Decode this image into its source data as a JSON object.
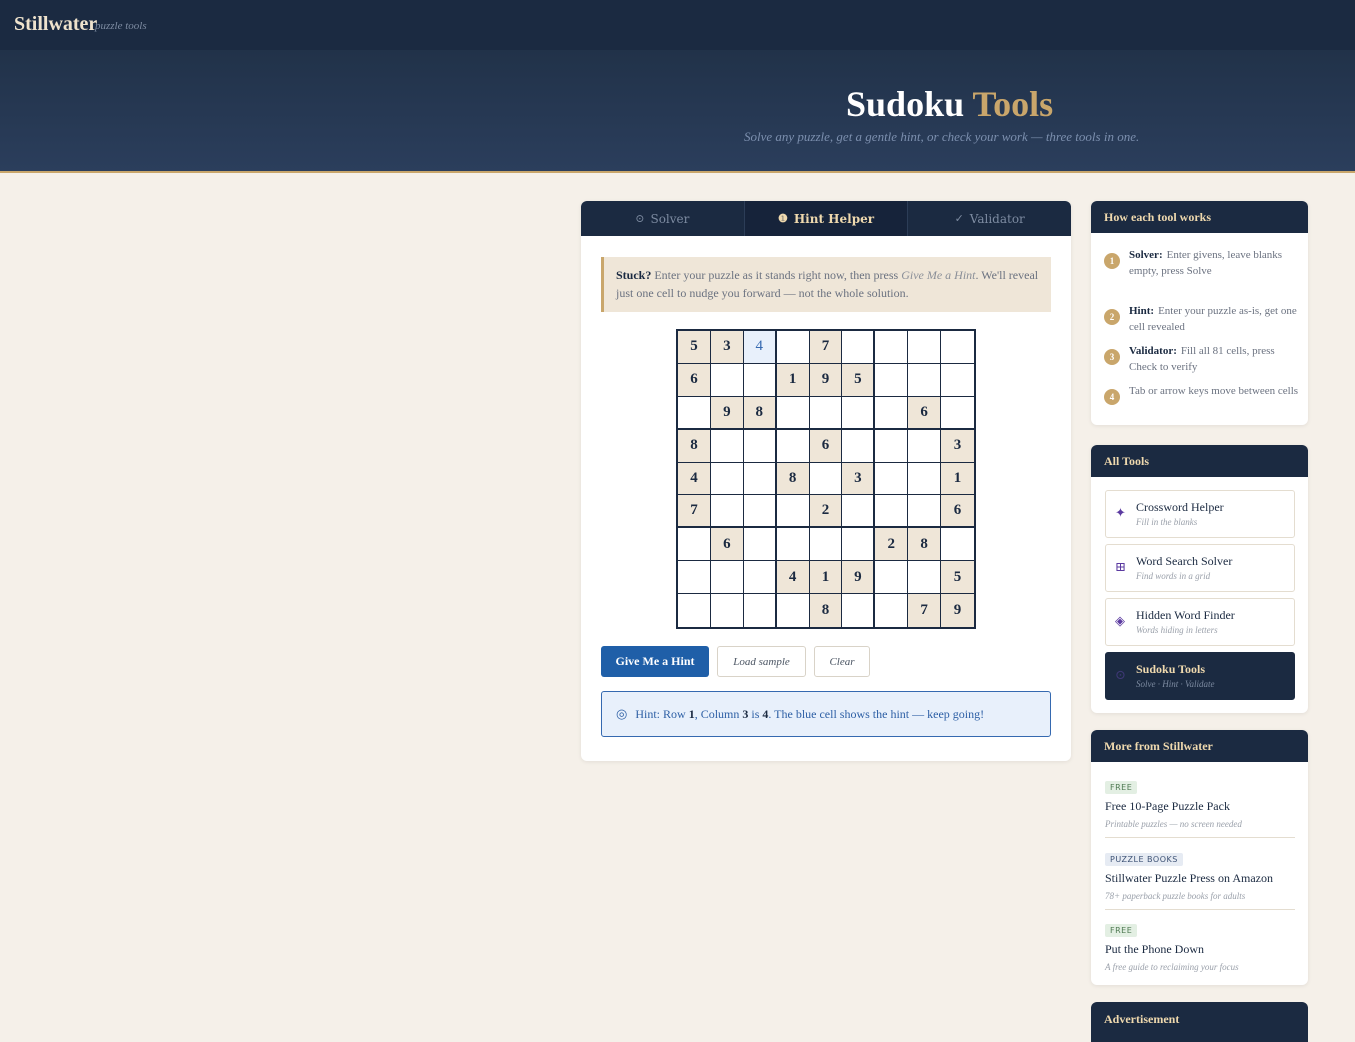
{
  "header": {
    "brand": "Stillwater",
    "tagline": "puzzle tools"
  },
  "hero": {
    "title_main": "Sudoku ",
    "title_accent": "Tools",
    "subtitle": "Solve any puzzle, get a gentle hint, or check your work — three tools in one."
  },
  "tabs": [
    {
      "icon": "⊙",
      "label": "Solver",
      "active": false
    },
    {
      "icon": "❶",
      "label": "Hint Helper",
      "active": true
    },
    {
      "icon": "✓",
      "label": "Validator",
      "active": false
    }
  ],
  "notice": {
    "lead": "Stuck?",
    "text1": " Enter your puzzle as it stands right now, then press ",
    "em": "Give Me a Hint",
    "text2": ". We'll reveal just one cell to nudge you forward — not the whole solution."
  },
  "grid": [
    [
      "5",
      "3",
      "4",
      "",
      "7",
      "",
      "",
      "",
      ""
    ],
    [
      "6",
      "",
      "",
      "1",
      "9",
      "5",
      "",
      "",
      ""
    ],
    [
      "",
      "9",
      "8",
      "",
      "",
      "",
      "",
      "6",
      ""
    ],
    [
      "8",
      "",
      "",
      "",
      "6",
      "",
      "",
      "",
      "3"
    ],
    [
      "4",
      "",
      "",
      "8",
      "",
      "3",
      "",
      "",
      "1"
    ],
    [
      "7",
      "",
      "",
      "",
      "2",
      "",
      "",
      "",
      "6"
    ],
    [
      "",
      "6",
      "",
      "",
      "",
      "",
      "2",
      "8",
      ""
    ],
    [
      "",
      "",
      "",
      "4",
      "1",
      "9",
      "",
      "",
      "5"
    ],
    [
      "",
      "",
      "",
      "",
      "8",
      "",
      "",
      "7",
      "9"
    ]
  ],
  "hint_cell": {
    "row": 1,
    "col": 3
  },
  "buttons": {
    "hint": "Give Me a Hint",
    "load": "Load sample",
    "clear": "Clear"
  },
  "hint_result": {
    "icon": "◎",
    "p1": "Hint: Row ",
    "row": "1",
    "p2": ", Column ",
    "col": "3",
    "p3": " is ",
    "val": "4",
    "p4": ". The blue cell shows the hint — keep going!"
  },
  "how": {
    "title": "How each tool works",
    "steps": [
      {
        "n": "1",
        "label": "Solver:",
        "text": "Enter givens, leave blanks empty, press Solve"
      },
      {
        "n": "2",
        "label": "Hint:",
        "text": "Enter your puzzle as-is, get one cell revealed"
      },
      {
        "n": "3",
        "label": "Validator:",
        "text": "Fill all 81 cells, press Check to verify"
      },
      {
        "n": "4",
        "label": "",
        "text": "Tab or arrow keys move between cells"
      }
    ]
  },
  "tools": {
    "title": "All Tools",
    "items": [
      {
        "icon": "✦",
        "name": "Crossword Helper",
        "desc": "Fill in the blanks"
      },
      {
        "icon": "⊞",
        "name": "Word Search Solver",
        "desc": "Find words in a grid"
      },
      {
        "icon": "◈",
        "name": "Hidden Word Finder",
        "desc": "Words hiding in letters"
      },
      {
        "icon": "⊙",
        "name": "Sudoku Tools",
        "desc": "Solve · Hint · Validate"
      }
    ]
  },
  "more": {
    "title": "More from Stillwater",
    "items": [
      {
        "badge": "FREE",
        "title": "Free 10-Page Puzzle Pack",
        "desc": "Printable puzzles — no screen needed"
      },
      {
        "badge": "PUZZLE BOOKS",
        "title": "Stillwater Puzzle Press on Amazon",
        "desc": "78+ paperback puzzle books for adults"
      },
      {
        "badge": "FREE",
        "title": "Put the Phone Down",
        "desc": "A free guide to reclaiming your focus"
      }
    ]
  },
  "ad": {
    "title": "Advertisement"
  },
  "colors": {
    "navy": "#1b2a41",
    "gold": "#c9a66b",
    "hint_blue": "#1f5fa8",
    "given_bg": "#efe6d8"
  }
}
